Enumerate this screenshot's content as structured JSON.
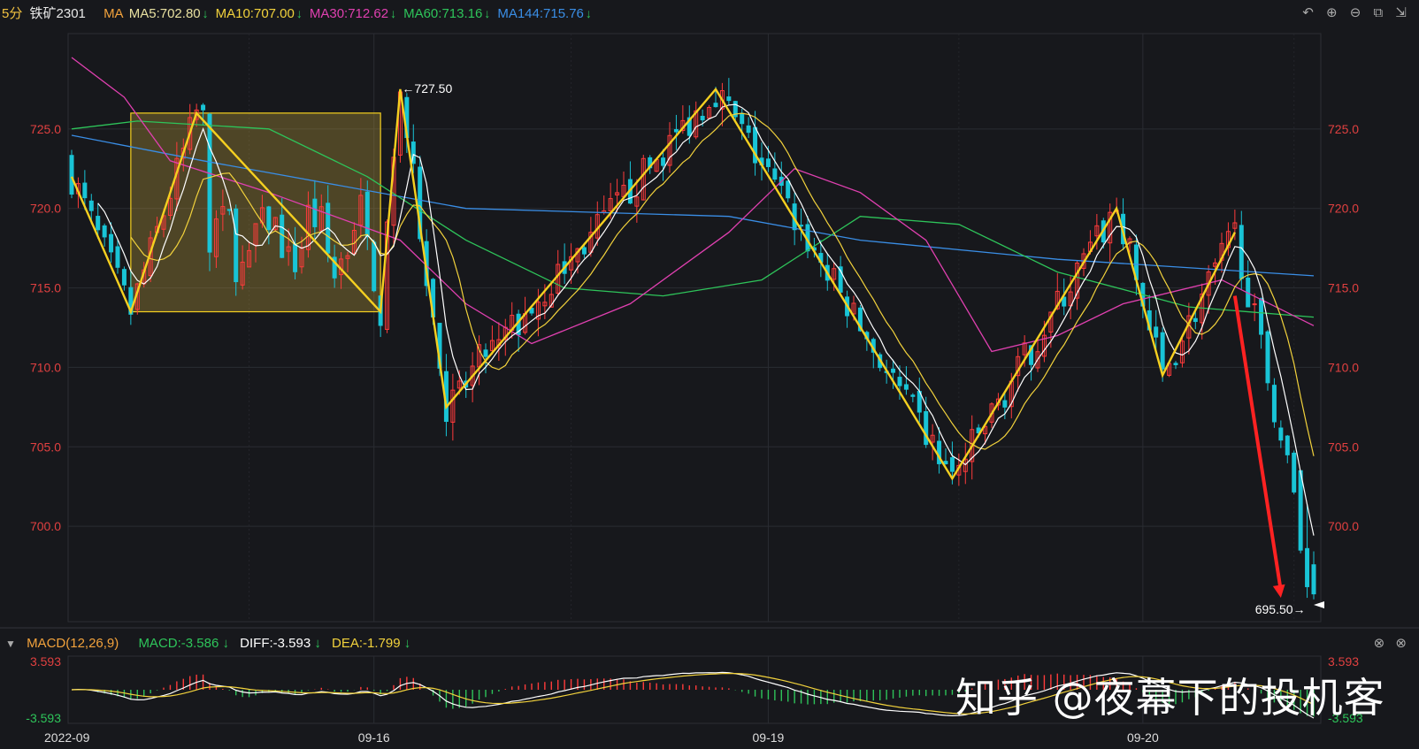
{
  "header": {
    "period": "5分",
    "symbol": "铁矿2301",
    "ma_label": "MA",
    "ma_items": [
      {
        "label": "MA5:702.80",
        "color": "#e8e0a0",
        "arrow": "↓"
      },
      {
        "label": "MA10:707.00",
        "color": "#f2d23c",
        "arrow": "↓"
      },
      {
        "label": "MA30:712.62",
        "color": "#e040b0",
        "arrow": "↓"
      },
      {
        "label": "MA60:713.16",
        "color": "#2ec45a",
        "arrow": "↓"
      },
      {
        "label": "MA144:715.76",
        "color": "#3a8ee6",
        "arrow": "↓"
      }
    ],
    "tools": [
      "↶",
      "⊕",
      "⊖",
      "⧉",
      "⇲"
    ]
  },
  "macd_header": {
    "indicator": "MACD(12,26,9)",
    "macd": "MACD:-3.586",
    "diff": "DIFF:-3.593",
    "dea": "DEA:-1.799",
    "arrow": "↓",
    "tools": [
      "⊗",
      "⊗"
    ]
  },
  "watermark": "知乎 @夜幕下的投机客",
  "colors": {
    "up": "#ff3b3b",
    "down": "#19c4d6",
    "ma5": "#ffffff",
    "ma10": "#f2d23c",
    "ma30": "#e040b0",
    "ma60": "#2ec45a",
    "ma144": "#3a8ee6",
    "zigzag": "#f5d020",
    "box": "#f5d020",
    "arrow": "#ff2222"
  },
  "chart_data": [
    {
      "type": "candlestick",
      "title": "铁矿2301 5分",
      "ylim": [
        694.0,
        731.0
      ],
      "y_ticks": [
        "725.0",
        "720.0",
        "715.0",
        "710.0",
        "705.0",
        "700.0"
      ],
      "x_ticks": [
        "2022-09",
        "09-16",
        "09-19",
        "09-20"
      ],
      "grid": true,
      "bars": 190,
      "annotations": [
        {
          "text": "←727.50",
          "value": 727.5
        },
        {
          "text": "695.50→",
          "value": 695.5
        }
      ],
      "zigzag": [
        {
          "bar": 0,
          "value": 722.0
        },
        {
          "bar": 9,
          "value": 713.5
        },
        {
          "bar": 19,
          "value": 726.0
        },
        {
          "bar": 47,
          "value": 713.5
        },
        {
          "bar": 50,
          "value": 727.5
        },
        {
          "bar": 57,
          "value": 707.5
        },
        {
          "bar": 98,
          "value": 727.5
        },
        {
          "bar": 134,
          "value": 703.0
        },
        {
          "bar": 159,
          "value": 720.0
        },
        {
          "bar": 166,
          "value": 709.5
        },
        {
          "bar": 177,
          "value": 718.5
        }
      ],
      "box": {
        "bar_start": 9,
        "bar_end": 47,
        "value_low": 713.5,
        "value_high": 726.0
      },
      "arrow": {
        "bar_start": 177,
        "value_start": 714.5,
        "bar_end": 184,
        "value_end": 695.5
      },
      "ma144_path": [
        [
          0,
          724.6
        ],
        [
          20,
          723.0
        ],
        [
          60,
          720.0
        ],
        [
          100,
          719.5
        ],
        [
          120,
          718.0
        ],
        [
          150,
          716.8
        ],
        [
          189,
          715.76
        ]
      ],
      "ma60_path": [
        [
          0,
          725.0
        ],
        [
          10,
          725.5
        ],
        [
          30,
          725.0
        ],
        [
          45,
          722.0
        ],
        [
          60,
          718.0
        ],
        [
          75,
          715.0
        ],
        [
          90,
          714.5
        ],
        [
          105,
          715.5
        ],
        [
          120,
          719.5
        ],
        [
          135,
          719.0
        ],
        [
          150,
          716.0
        ],
        [
          170,
          713.8
        ],
        [
          189,
          713.16
        ]
      ],
      "ma30_path": [
        [
          0,
          729.5
        ],
        [
          8,
          727.0
        ],
        [
          15,
          723.0
        ],
        [
          30,
          721.0
        ],
        [
          50,
          718.0
        ],
        [
          60,
          714.0
        ],
        [
          70,
          711.5
        ],
        [
          85,
          714.0
        ],
        [
          100,
          718.5
        ],
        [
          110,
          722.5
        ],
        [
          120,
          721.0
        ],
        [
          130,
          718.0
        ],
        [
          140,
          711.0
        ],
        [
          150,
          712.0
        ],
        [
          160,
          714.0
        ],
        [
          175,
          715.5
        ],
        [
          189,
          712.62
        ]
      ]
    },
    {
      "type": "macd",
      "ylim": [
        -3.593,
        3.593
      ],
      "y_ticks": [
        "3.593",
        "-3.593"
      ],
      "series": [
        {
          "name": "DIFF",
          "value": -3.593
        },
        {
          "name": "DEA",
          "value": -1.799
        },
        {
          "name": "MACD",
          "value": -3.586
        }
      ]
    }
  ]
}
